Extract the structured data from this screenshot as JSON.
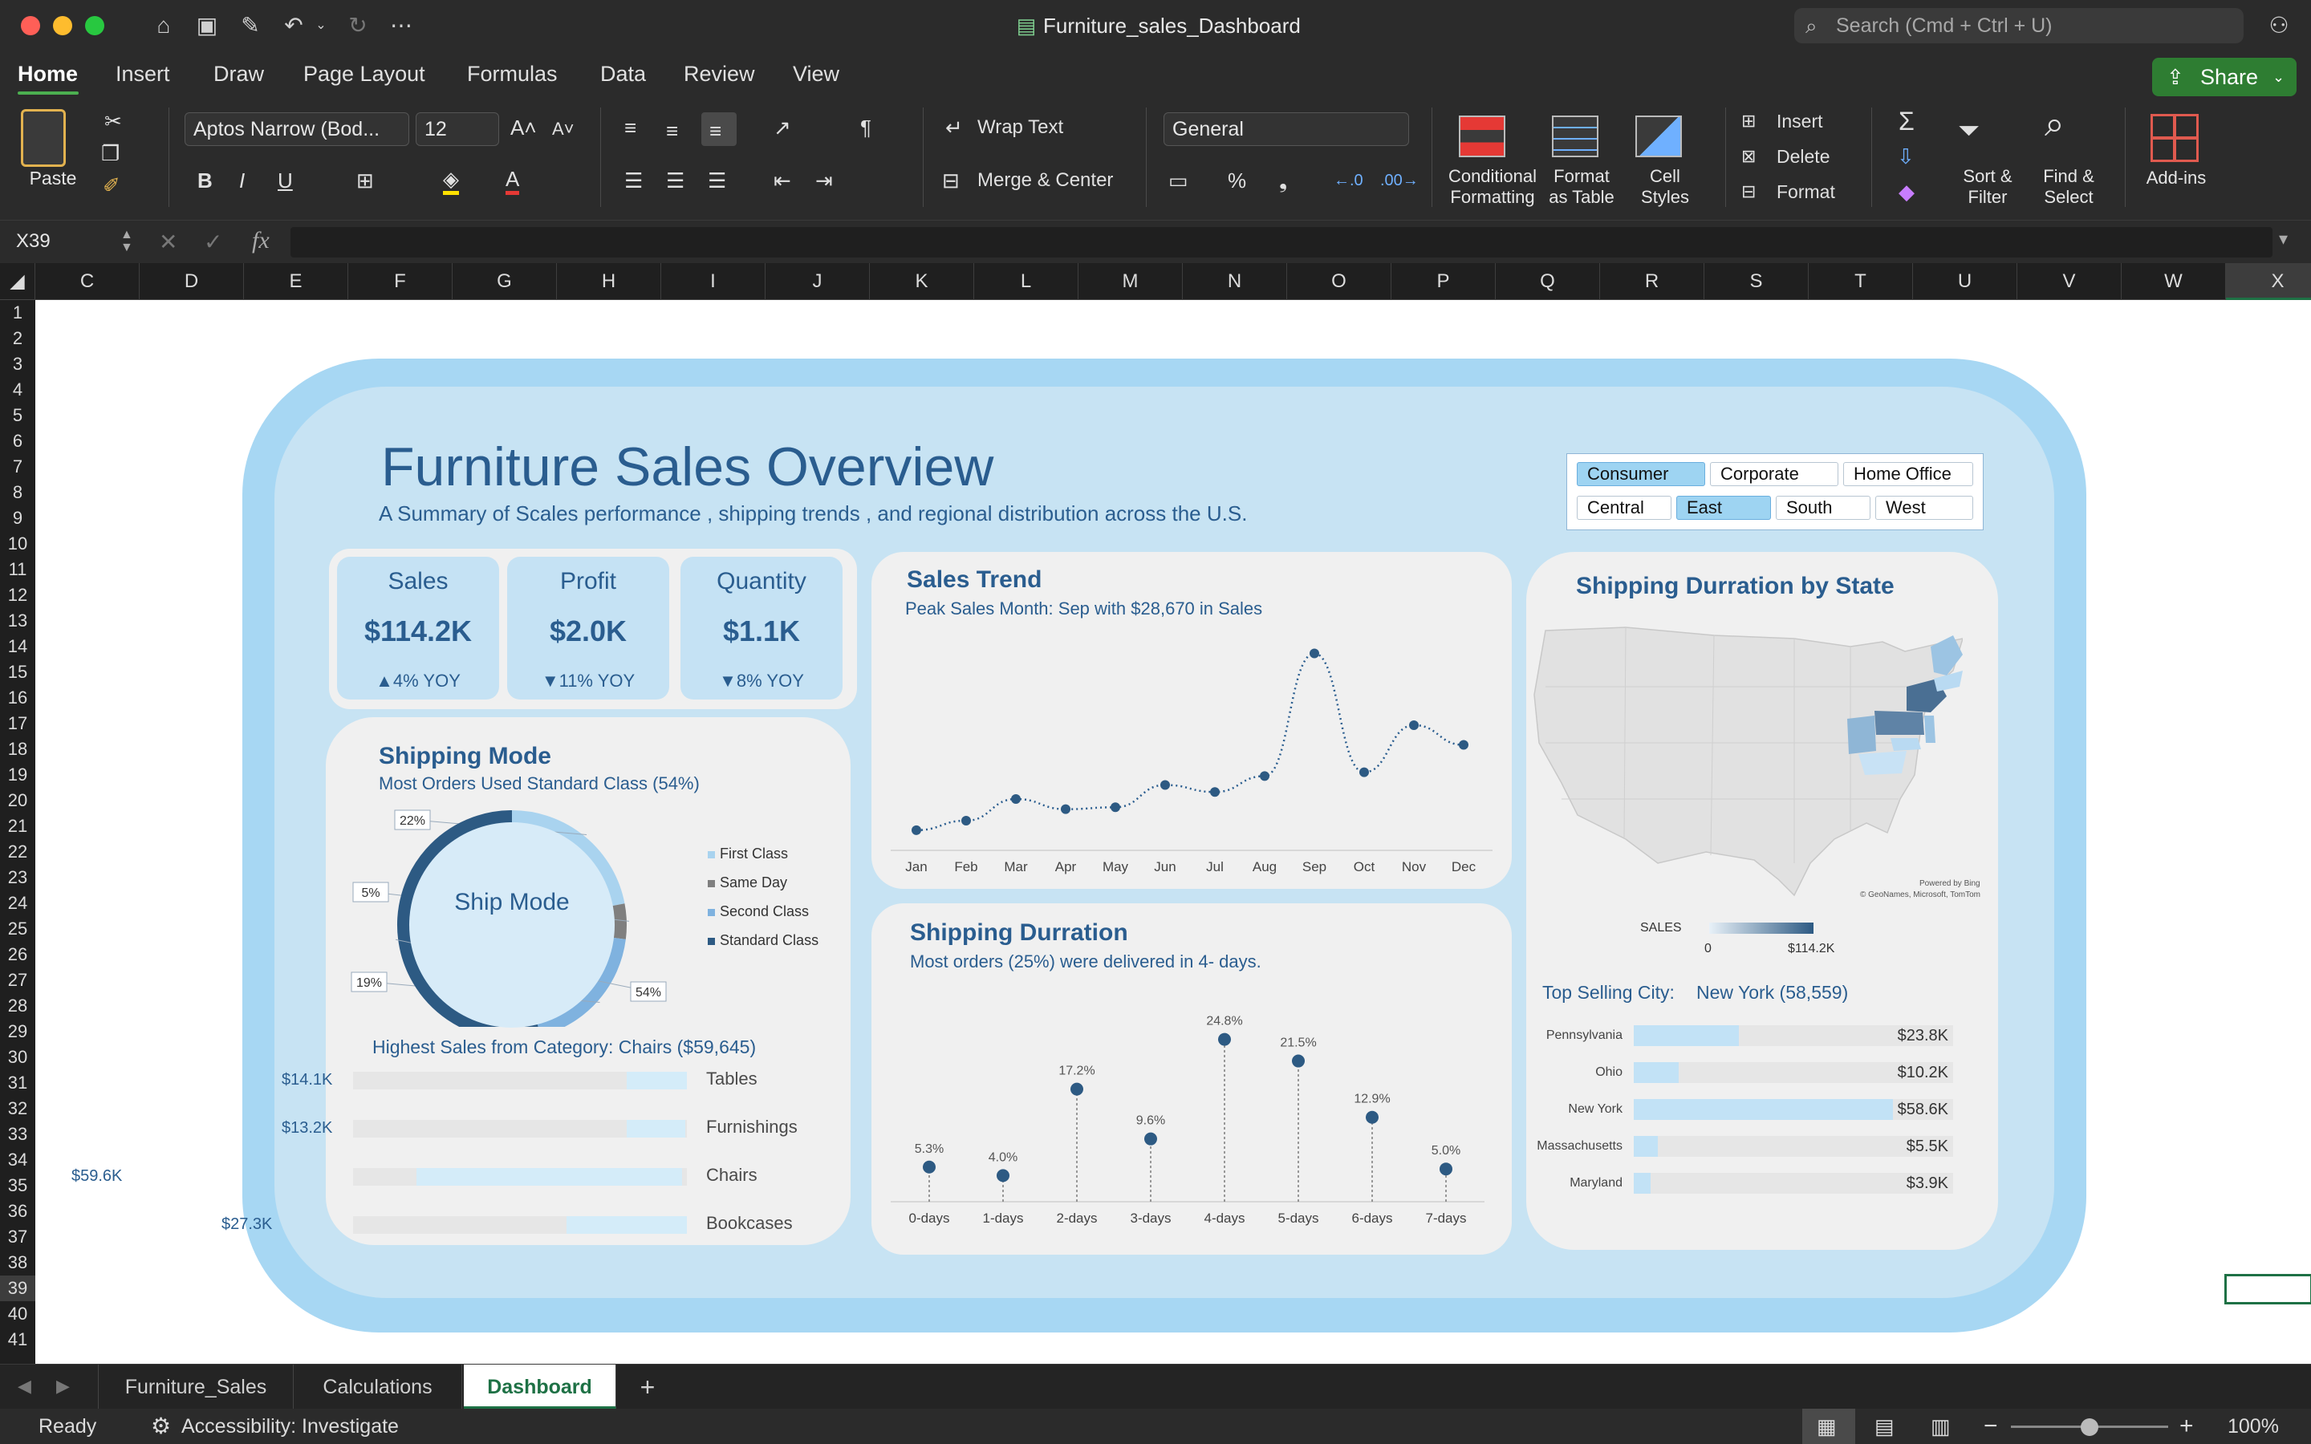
{
  "window": {
    "title": "Furniture_sales_Dashboard",
    "search_placeholder": "Search (Cmd + Ctrl + U)"
  },
  "menu": {
    "tabs": [
      "Home",
      "Insert",
      "Draw",
      "Page Layout",
      "Formulas",
      "Data",
      "Review",
      "View"
    ],
    "active": "Home",
    "share_label": "Share"
  },
  "ribbon": {
    "paste": "Paste",
    "font_name": "Aptos Narrow (Bod...",
    "font_size": "12",
    "wrap_text": "Wrap Text",
    "merge_center": "Merge & Center",
    "number_format": "General",
    "conditional_1": "Conditional",
    "conditional_2": "Formatting",
    "format_table_1": "Format",
    "format_table_2": "as Table",
    "cell_styles_1": "Cell",
    "cell_styles_2": "Styles",
    "insert": "Insert",
    "delete": "Delete",
    "format": "Format",
    "sort_filter_1": "Sort &",
    "sort_filter_2": "Filter",
    "find_select_1": "Find &",
    "find_select_2": "Select",
    "addins": "Add-ins",
    "bold": "B",
    "italic": "I",
    "underline": "U",
    "percent": "%"
  },
  "formula_bar": {
    "name_box": "X39",
    "fx": "fx",
    "value": ""
  },
  "columns": [
    "C",
    "D",
    "E",
    "F",
    "G",
    "H",
    "I",
    "J",
    "K",
    "L",
    "M",
    "N",
    "O",
    "P",
    "Q",
    "R",
    "S",
    "T",
    "U",
    "V",
    "W",
    "X"
  ],
  "rows": [
    "1",
    "2",
    "3",
    "4",
    "5",
    "6",
    "7",
    "8",
    "9",
    "10",
    "11",
    "12",
    "13",
    "14",
    "15",
    "16",
    "17",
    "18",
    "19",
    "20",
    "21",
    "22",
    "23",
    "24",
    "25",
    "26",
    "27",
    "28",
    "29",
    "30",
    "31",
    "32",
    "33",
    "34",
    "35",
    "36",
    "37",
    "38",
    "39",
    "40",
    "41"
  ],
  "selected_cell": {
    "column": "X",
    "row": "39"
  },
  "dashboard": {
    "title": "Furniture Sales Overview",
    "subtitle": "A Summary of Scales performance , shipping trends , and regional distribution across the U.S.",
    "segments": [
      {
        "label": "Consumer",
        "selected": true
      },
      {
        "label": "Corporate",
        "selected": false
      },
      {
        "label": "Home Office",
        "selected": false
      }
    ],
    "regions": [
      {
        "label": "Central",
        "selected": false
      },
      {
        "label": "East",
        "selected": true
      },
      {
        "label": "South",
        "selected": false
      },
      {
        "label": "West",
        "selected": false
      }
    ],
    "kpis": [
      {
        "label": "Sales",
        "value": "$114.2K",
        "yoy": "▲4% YOY"
      },
      {
        "label": "Profit",
        "value": "$2.0K",
        "yoy": "▼11% YOY"
      },
      {
        "label": "Quantity",
        "value": "$1.1K",
        "yoy": "▼8% YOY"
      }
    ],
    "sales_trend": {
      "title": "Sales Trend",
      "subtitle": "Peak Sales Month: Sep with $28,670 in Sales"
    },
    "shipping_mode": {
      "title": "Shipping Mode",
      "subtitle": "Most Orders Used Standard Class (54%)",
      "center_label": "Ship Mode"
    },
    "category": {
      "title": "Highest Sales from  Category: Chairs ($59,645)"
    },
    "shipping_duration": {
      "title": "Shipping Durration",
      "subtitle": "Most orders (25%) were delivered in 4- days."
    },
    "state_map": {
      "title": "Shipping Durration by State",
      "credit_1": "Powered by Bing",
      "credit_2": "© GeoNames, Microsoft, TomTom",
      "legend_label": "SALES",
      "legend_min": "0",
      "legend_max": "$114.2K",
      "highlight_color": "#4a6f93",
      "mid_color": "#8fb6d6",
      "light_color": "#b9daf2"
    },
    "top_city": {
      "label": "Top Selling City:",
      "value": "New York (58,559)"
    }
  },
  "chart_data": [
    {
      "type": "line",
      "title": "Sales Trend",
      "categories": [
        "Jan",
        "Feb",
        "Mar",
        "Apr",
        "May",
        "Jun",
        "Jul",
        "Aug",
        "Sep",
        "Oct",
        "Nov",
        "Dec"
      ],
      "values": [
        900,
        2400,
        5800,
        4200,
        4500,
        8000,
        6900,
        9400,
        28670,
        10000,
        17400,
        14300
      ],
      "ylim": [
        0,
        30000
      ],
      "grid": false,
      "style": "dotted",
      "color": "#2a5d8f"
    },
    {
      "type": "pie",
      "title": "Shipping Mode",
      "categories": [
        "First Class",
        "Same Day",
        "Second Class",
        "Standard Class"
      ],
      "values": [
        22,
        5,
        19,
        54
      ],
      "value_labels": [
        "22%",
        "5%",
        "19%",
        "54%"
      ],
      "colors": [
        "#a9d3ef",
        "#7f7f7f",
        "#7fb2df",
        "#2d5a83"
      ],
      "legend": "right"
    },
    {
      "type": "bar",
      "orientation": "horizontal",
      "title": "Highest Sales from  Category: Chairs ($59,645)",
      "categories": [
        "Tables",
        "Furnishings",
        "Chairs",
        "Bookcases"
      ],
      "values": [
        14100,
        13200,
        59600,
        27300
      ],
      "value_labels": [
        "$14.1K",
        "$13.2K",
        "$59.6K",
        "$27.3K"
      ]
    },
    {
      "type": "scatter",
      "style": "lollipop",
      "title": "Shipping Durration",
      "categories": [
        "0-days",
        "1-days",
        "2-days",
        "3-days",
        "4-days",
        "5-days",
        "6-days",
        "7-days"
      ],
      "values": [
        5.3,
        4.0,
        17.2,
        9.6,
        24.8,
        21.5,
        12.9,
        5.0
      ],
      "value_labels": [
        "5.3%",
        "4.0%",
        "17.2%",
        "9.6%",
        "24.8%",
        "21.5%",
        "12.9%",
        "5.0%"
      ],
      "ylim": [
        0,
        30
      ]
    },
    {
      "type": "bar",
      "orientation": "horizontal",
      "title": "Top Selling City:  New York (58,559)",
      "categories": [
        "Pennsylvania",
        "Ohio",
        "New York",
        "Massachusetts",
        "Maryland"
      ],
      "values": [
        23800,
        10200,
        58600,
        5500,
        3900
      ],
      "value_labels": [
        "$23.8K",
        "$10.2K",
        "$58.6K",
        "$5.5K",
        "$3.9K"
      ]
    }
  ],
  "sheets": {
    "tabs": [
      "Furniture_Sales",
      "Calculations",
      "Dashboard"
    ],
    "active": "Dashboard",
    "add": "+"
  },
  "status": {
    "ready": "Ready",
    "accessibility": "Accessibility: Investigate",
    "zoom": "100%",
    "zoom_level": 1.0,
    "minus": "−",
    "plus": "+"
  }
}
